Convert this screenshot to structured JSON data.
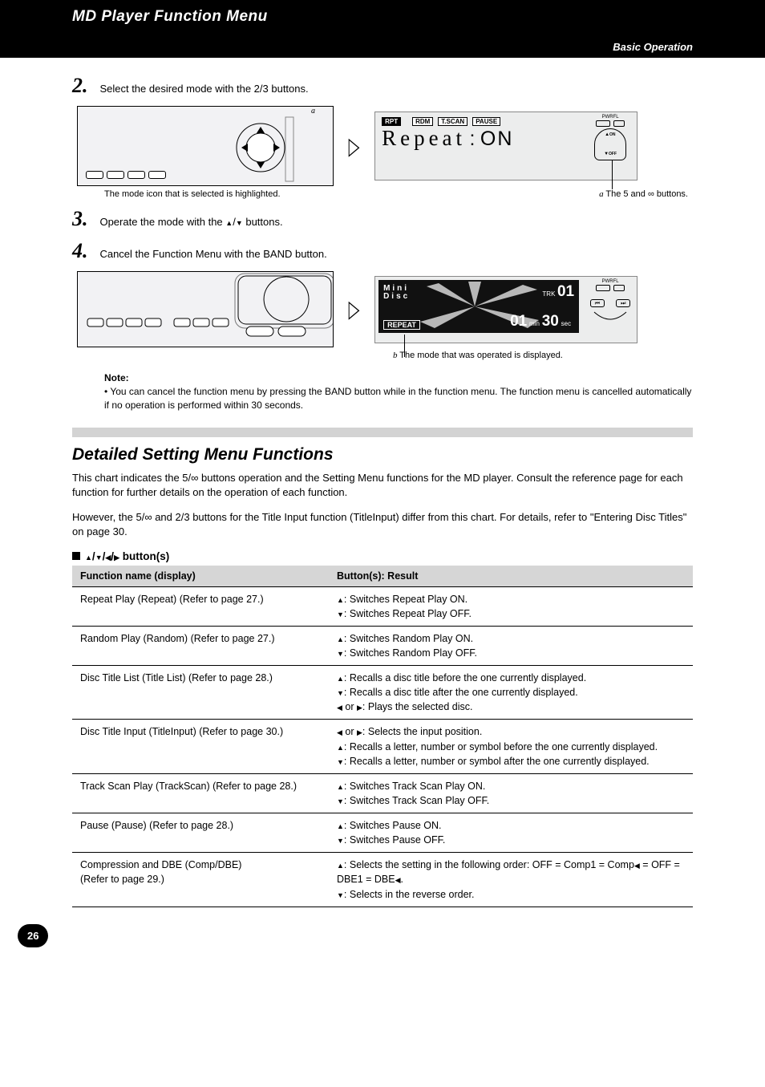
{
  "header": {
    "title": "MD Player Function Menu",
    "subtitle": "Basic Operation"
  },
  "steps": {
    "s2_num": "2.",
    "s2_text": "Select the desired mode with the 2/3 buttons.",
    "s2_caption": "The mode icon that is selected is highlighted.",
    "lcd": {
      "rpt": "RPT",
      "rdm": "RDM",
      "tscan": "T.SCAN",
      "pause": "PAUSE",
      "main": "Repeat",
      "value_label": ":",
      "value": "ON",
      "pwr_label": "PWRFL",
      "on_label": "ON",
      "off_label": "OFF"
    },
    "pointer_a": "The 5 and ∞ buttons.",
    "s3_num": "3.",
    "s3_text_1": "Operate the mode with the ",
    "s3_up_hint": "5",
    "s3_down_hint": "∞",
    "s3_text_mid": "/",
    "s3_text_2": " buttons.",
    "s4_num": "4.",
    "s4_text": "Cancel the Function Menu with the BAND button.",
    "lcd2": {
      "mini": "Mini",
      "disc": "Disc",
      "trk_label": "TRK",
      "trk_val": "01",
      "repeat": "REPEAT",
      "min_val": "01",
      "min_label": "min",
      "sec_val": "30",
      "sec_label": "sec",
      "pwr": "PWRFL"
    },
    "pointer_b": "The mode that was operated is displayed.",
    "note": "You can cancel the function menu by pressing the BAND button while in the function menu. The function menu is cancelled automatically if no operation is performed within 30 seconds.",
    "note_label": "Note:"
  },
  "detailed": {
    "heading": "Detailed Setting Menu Functions",
    "intro_1": "This chart indicates the 5/∞ buttons operation and the Setting Menu functions for the MD player. Consult the reference page for each function for further details on the operation of each function.",
    "intro_2": "However, the 5/∞ and 2/3 buttons for the Title Input function (TitleInput) differ from this chart. For details, refer to \"Entering Disc Titles\" on page 30.",
    "table_title": "5/∞/2/3 button(s)",
    "cols": {
      "c1": "Function name (display)",
      "c2": "Button(s): Result"
    },
    "rows": [
      {
        "name_line": "Repeat Play (Repeat)",
        "page": "(Refer to page 27.)",
        "ops": "5: Switches Repeat Play ON.\n∞: Switches Repeat Play OFF."
      },
      {
        "name_line": "Random Play (Random)",
        "page": "(Refer to page 27.)",
        "ops": "5: Switches Random Play ON.\n∞: Switches Random Play OFF."
      },
      {
        "name_line": "Disc Title List (Title List)",
        "page": "(Refer to page 28.)",
        "ops": "5: Recalls a disc title before the one currently displayed.\n∞: Recalls a disc title after the one currently displayed.\n2 or 3: Plays the selected disc."
      },
      {
        "name_line": "Disc Title Input (TitleInput)",
        "page": "(Refer to page 30.)",
        "ops": "2 or 3: Selects the input position.\n5: Recalls a letter, number or symbol before the one currently displayed.\n∞: Recalls a letter, number or symbol after the one currently displayed."
      },
      {
        "name_line": "Track Scan Play (TrackScan)",
        "page": "(Refer to page 28.)",
        "ops": "5: Switches Track Scan Play ON.\n∞: Switches Track Scan Play OFF."
      },
      {
        "name_line": "Pause (Pause)",
        "page": "(Refer to page 28.)",
        "ops": "5: Switches Pause ON.\n∞: Switches Pause OFF."
      },
      {
        "name_line": "Compression and DBE (Comp/DBE)",
        "page": "(Refer to page 29.)",
        "ops": "5: Selects the setting in the following order: OFF = Comp1 = Comp2 = OFF = DBE1 = DBE2.\n∞: Selects in the reverse order."
      }
    ]
  },
  "page_number": "26"
}
